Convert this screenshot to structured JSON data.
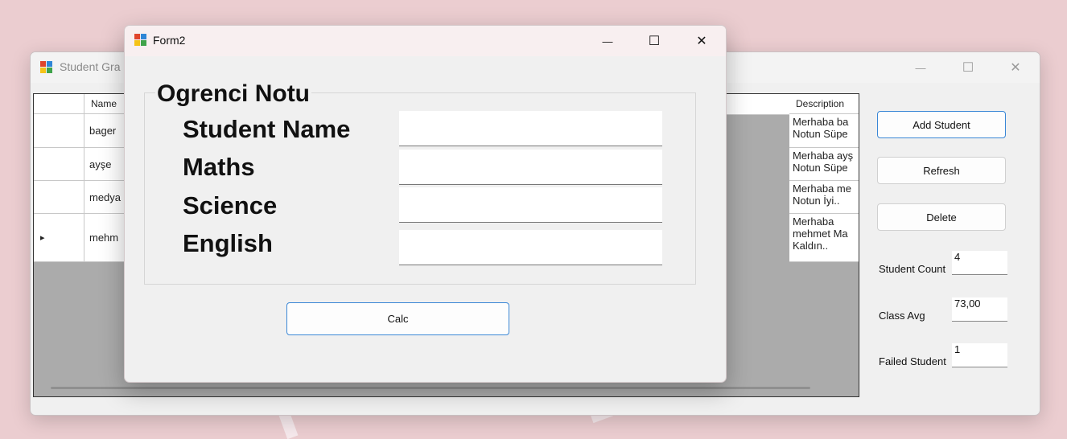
{
  "main_window": {
    "title": "Student Gra",
    "grid": {
      "headers": {
        "name": "Name",
        "description": "Description"
      },
      "rows": [
        {
          "name": "bager",
          "description": "Merhaba ba\nNotun Süpe"
        },
        {
          "name": "ayşe",
          "description": "Merhaba ayş\nNotun Süpe"
        },
        {
          "name": "medya",
          "description": "Merhaba me\nNotun İyi.."
        },
        {
          "name": "mehm",
          "description": "Merhaba\nmehmet Ma\nKaldın.."
        }
      ],
      "current_row_marker": "▸"
    },
    "buttons": {
      "add": "Add Student",
      "refresh": "Refresh",
      "delete": "Delete"
    },
    "stats": {
      "student_count_label": "Student Count",
      "student_count_value": "4",
      "class_avg_label": "Class Avg",
      "class_avg_value": "73,00",
      "failed_label": "Failed Student",
      "failed_value": "1"
    }
  },
  "form2": {
    "title": "Form2",
    "group_title": "Ogrenci Notu",
    "labels": {
      "student_name": "Student Name",
      "maths": "Maths",
      "science": "Science",
      "english": "English"
    },
    "values": {
      "student_name": "",
      "maths": "",
      "science": "",
      "english": ""
    },
    "calc_label": "Calc"
  },
  "window_controls": {
    "minimize": "—",
    "maximize": "☐",
    "close": "✕"
  },
  "colors": {
    "desktop": "#ebcdd0",
    "accent": "#3a87d6",
    "grid_bg": "#ababab"
  }
}
